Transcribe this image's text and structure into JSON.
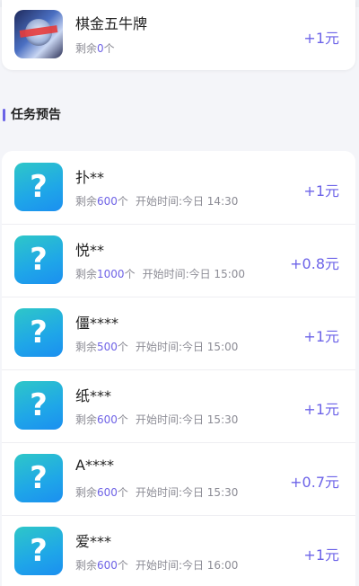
{
  "top_item": {
    "title": "棋金五牛牌",
    "remaining_prefix": "剩余",
    "remaining_count": "0",
    "remaining_unit": "个",
    "reward": "+1元"
  },
  "section": {
    "title": "任务预告"
  },
  "tasks": [
    {
      "title": "扑**",
      "remaining_prefix": "剩余",
      "remaining_count": "600",
      "remaining_unit": "个",
      "start_label": "开始时间:今日 14:30",
      "reward": "+1元",
      "icon": "question-mark"
    },
    {
      "title": "悦**",
      "remaining_prefix": "剩余",
      "remaining_count": "1000",
      "remaining_unit": "个",
      "start_label": "开始时间:今日 15:00",
      "reward": "+0.8元",
      "icon": "question-mark"
    },
    {
      "title": "僵****",
      "remaining_prefix": "剩余",
      "remaining_count": "500",
      "remaining_unit": "个",
      "start_label": "开始时间:今日 15:00",
      "reward": "+1元",
      "icon": "question-mark"
    },
    {
      "title": "纸***",
      "remaining_prefix": "剩余",
      "remaining_count": "600",
      "remaining_unit": "个",
      "start_label": "开始时间:今日 15:30",
      "reward": "+1元",
      "icon": "question-mark"
    },
    {
      "title": "A****",
      "remaining_prefix": "剩余",
      "remaining_count": "600",
      "remaining_unit": "个",
      "start_label": "开始时间:今日 15:30",
      "reward": "+0.7元",
      "icon": "question-mark"
    },
    {
      "title": "爱***",
      "remaining_prefix": "剩余",
      "remaining_count": "600",
      "remaining_unit": "个",
      "start_label": "开始时间:今日 16:00",
      "reward": "+1元",
      "icon": "question-mark"
    }
  ],
  "icon_glyph": "?",
  "colors": {
    "accent": "#6c63e8",
    "icon_gradient_start": "#2ec7c8",
    "icon_gradient_end": "#1b8ff0",
    "background": "#f4f5f9"
  }
}
